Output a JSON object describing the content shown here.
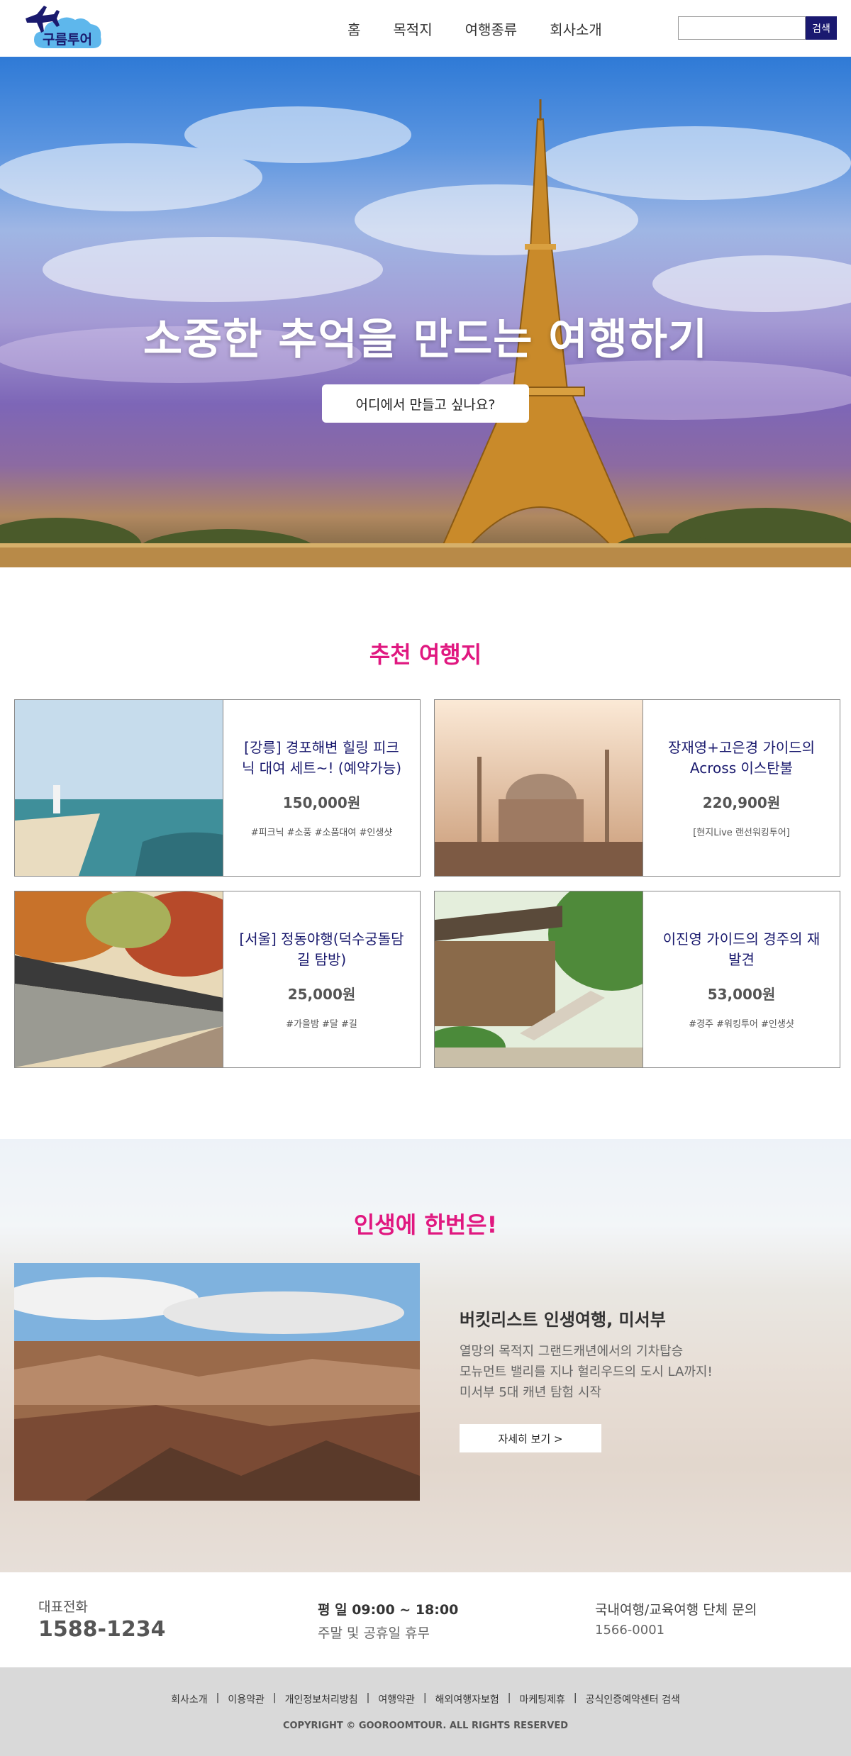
{
  "header": {
    "logo_text": "구름투어",
    "nav": [
      "홈",
      "목적지",
      "여행종류",
      "회사소개"
    ],
    "search_placeholder": "",
    "search_button": "검색"
  },
  "hero": {
    "title": "소중한 추억을 만드는 여행하기",
    "button": "어디에서 만들고 싶나요?"
  },
  "recommended": {
    "title": "추천 여행지",
    "cards": [
      {
        "title": "[강릉] 경포해변 힐링 피크닉 대여 세트~! (예약가능)",
        "price": "150,000원",
        "tags": "#피크닉 #소풍 #소품대여 #인생샷",
        "image": "beach-photo"
      },
      {
        "title": "장재영+고은경 가이드의 Across 이스탄불",
        "price": "220,900원",
        "tags": "[현지Live 랜선워킹투어]",
        "image": "istanbul-mosque-photo"
      },
      {
        "title": "[서울] 정동야행(덕수궁돌담길 탐방)",
        "price": "25,000원",
        "tags": "#가을밤 #달 #길",
        "image": "stone-wall-road-photo"
      },
      {
        "title": "이진영 가이드의 경주의 재발견",
        "price": "53,000원",
        "tags": "#경주 #워킹투어 #인생샷",
        "image": "bulguksa-temple-photo"
      }
    ]
  },
  "lifetime": {
    "title": "인생에 한번은!",
    "heading": "버킷리스트 인생여행, 미서부",
    "lines": [
      "열망의 목적지 그랜드캐년에서의 기차탑승",
      "모뉴먼트 밸리를 지나 헐리우드의 도시 LA까지!",
      "미서부 5대 캐년 탐험 시작"
    ],
    "button": "자세히 보기 >"
  },
  "infos": {
    "tel_label": "대표전화",
    "tel_number": "1588-1234",
    "hours_line1": "평 일  09:00 ~ 18:00",
    "hours_line2": "주말 및 공휴일 휴무",
    "group_line1": "국내여행/교육여행 단체 문의",
    "group_line2": "1566-0001"
  },
  "footer": {
    "links": [
      "회사소개",
      "이용약관",
      "개인정보처리방침",
      "여행약관",
      "해외여행자보험",
      "마케팅제휴",
      "공식인증예약센터 검색"
    ],
    "copyright": "COPYRIGHT © GOOROOMTOUR. ALL RIGHTS RESERVED"
  },
  "colors": {
    "accent_pink": "#e01880",
    "navy": "#1a1970",
    "footer_bg": "#d9d9d9"
  }
}
